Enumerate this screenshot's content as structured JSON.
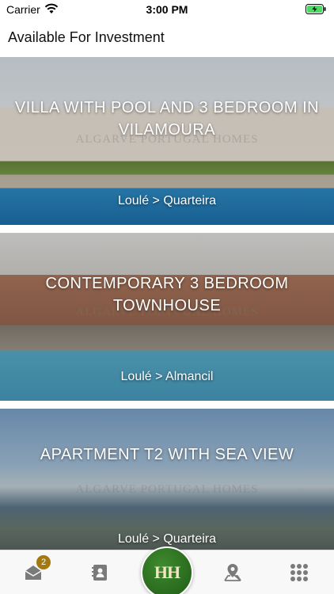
{
  "status_bar": {
    "carrier": "Carrier",
    "time": "3:00 PM"
  },
  "header": {
    "title": "Available For Investment"
  },
  "listings": [
    {
      "title": "VILLA WITH POOL AND 3 BEDROOM IN VILAMOURA",
      "location": "Loulé > Quarteira",
      "watermark": "ALGARVE PORTUGAL HOMES"
    },
    {
      "title": "CONTEMPORARY 3 BEDROOM TOWNHOUSE",
      "location": "Loulé > Almancil",
      "watermark": "ALGARVE PORTUGAL HOMES"
    },
    {
      "title": "APARTMENT T2 WITH SEA VIEW",
      "location": "Loulé > Quarteira",
      "watermark": "ALGARVE PORTUGAL HOMES"
    }
  ],
  "tab_bar": {
    "messages_badge": "2",
    "home_logo": "HH",
    "icons": [
      "envelope-icon",
      "contacts-icon",
      "home-logo-icon",
      "map-pin-icon",
      "grid-icon"
    ],
    "accent": "#2c6e20",
    "badge_color": "#a3790f"
  }
}
